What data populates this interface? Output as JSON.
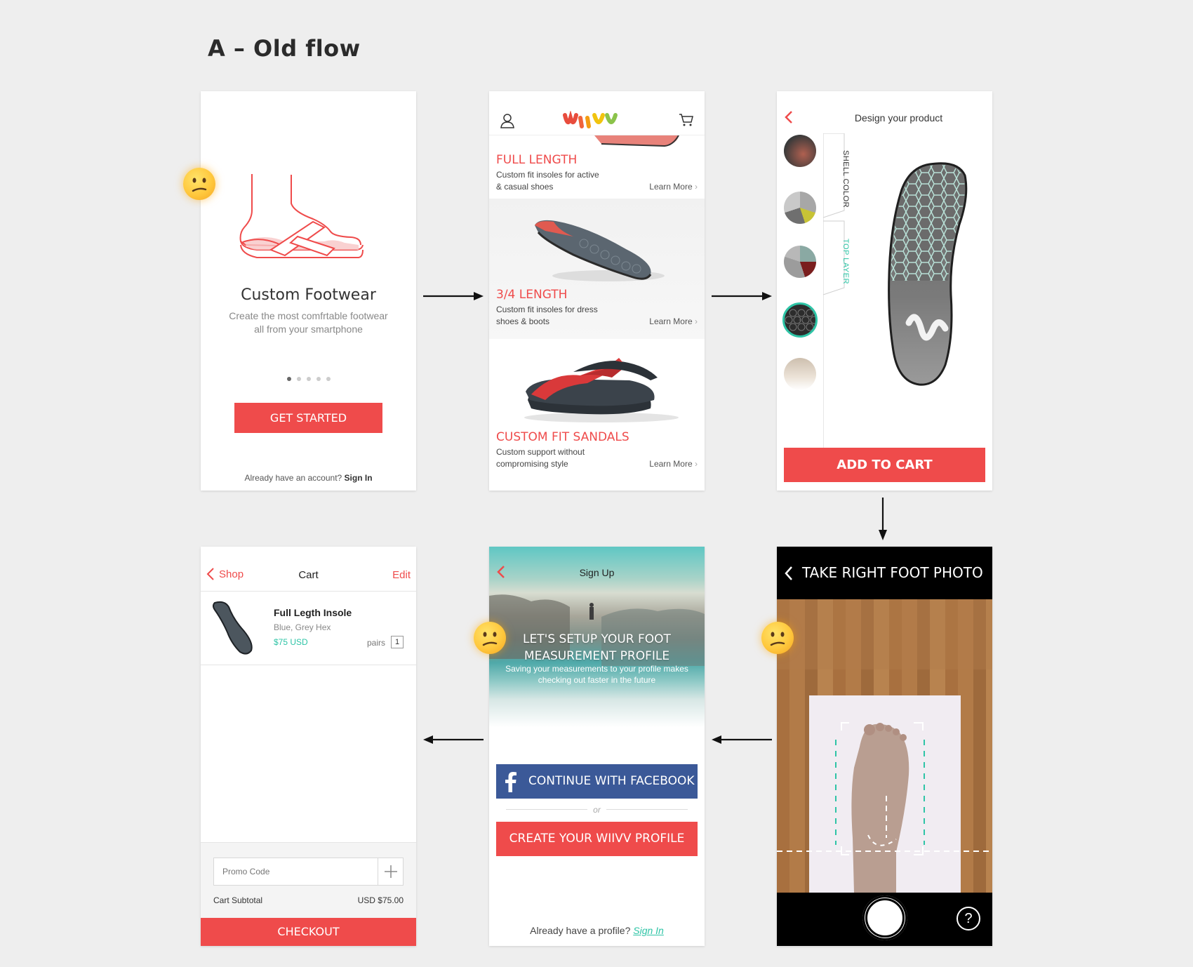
{
  "page": {
    "title": "A – Old flow"
  },
  "screen1": {
    "heading": "Custom Footwear",
    "subtitle_line1": "Create the most comfrtable footwear",
    "subtitle_line2": "all from your smartphone",
    "cta": "GET STARTED",
    "footer_text": "Already have an account?",
    "footer_link": "Sign In"
  },
  "screen2": {
    "products": [
      {
        "name": "FULL LENGTH",
        "desc_line1": "Custom fit insoles for active",
        "desc_line2": "& casual shoes",
        "link": "Learn More"
      },
      {
        "name": "3/4 LENGTH",
        "desc_line1": "Custom fit insoles for dress",
        "desc_line2": "shoes & boots",
        "link": "Learn More"
      },
      {
        "name": "CUSTOM FIT SANDALS",
        "desc_line1": "Custom support without",
        "desc_line2": "compromising style",
        "link": "Learn More"
      }
    ],
    "logo_colors": [
      "#e84c3d",
      "#f39c12",
      "#f1c40f",
      "#8bc34a",
      "#1abc9c"
    ]
  },
  "screen3": {
    "title": "Design your product",
    "tab_shell": "SHELL COLOR",
    "tab_top": "TOP LAYER",
    "cta": "ADD TO CART"
  },
  "screen4": {
    "back": "Shop",
    "title": "Cart",
    "edit": "Edit",
    "item_name": "Full Legth Insole",
    "item_variant": "Blue, Grey Hex",
    "item_price": "$75 USD",
    "qty_label": "pairs",
    "qty": "1",
    "promo_placeholder": "Promo Code",
    "subtotal_label": "Cart Subtotal",
    "subtotal_value": "USD $75.00",
    "cta": "CHECKOUT"
  },
  "screen5": {
    "title": "Sign Up",
    "headline_line1": "LET'S SETUP YOUR FOOT",
    "headline_line2": "MEASUREMENT PROFILE",
    "body_line1": "Saving your measurements to your profile makes",
    "body_line2": "checking out faster in the future",
    "facebook": "CONTINUE WITH FACEBOOK",
    "or": "or",
    "create": "CREATE YOUR WIIVV PROFILE",
    "footer_text": "Already have a profile?",
    "footer_link": "Sign In"
  },
  "screen6": {
    "title": "TAKE RIGHT FOOT PHOTO",
    "help": "?"
  },
  "colors": {
    "accent": "#ef4b4b",
    "teal": "#2ec4a6",
    "facebook": "#3b5998"
  }
}
